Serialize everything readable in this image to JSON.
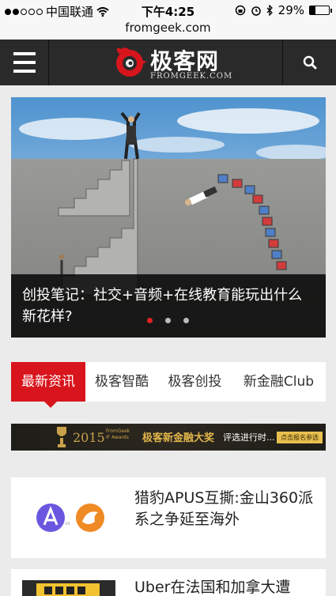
{
  "status_bar": {
    "carrier": "中国联通",
    "time": "下午4:25",
    "battery": "29%",
    "battery_level": 0.29
  },
  "url_bar": {
    "url": "fromgeek.com"
  },
  "header": {
    "logo_cn": "极客网",
    "logo_en": "FROMGEEK.COM",
    "menu_icon": "hamburger-icon",
    "search_icon": "search-icon"
  },
  "hero": {
    "caption": "创投笔记：社交+音频+在线教育能玩出什么新花样?",
    "active_slide": 1,
    "slide_count": 3
  },
  "tabs": [
    {
      "label": "最新资讯",
      "active": true
    },
    {
      "label": "极客智酷",
      "active": false
    },
    {
      "label": "极客创投",
      "active": false
    },
    {
      "label": "新金融Club",
      "active": false
    }
  ],
  "banner": {
    "year": "2015",
    "small_line1": "FromGeek",
    "small_line2": "IF Awards",
    "title": "极客新金融大奖",
    "subtitle": "评选进行时...",
    "button": "点击报名参选"
  },
  "articles": [
    {
      "title": "猎豹APUS互撕:金山360派系之争延至海外"
    },
    {
      "title": "Uber在法国和加拿大遭"
    }
  ],
  "colors": {
    "brand_red": "#d8151c",
    "header_bg": "#2a2a2a",
    "page_bg": "#ebebeb"
  }
}
